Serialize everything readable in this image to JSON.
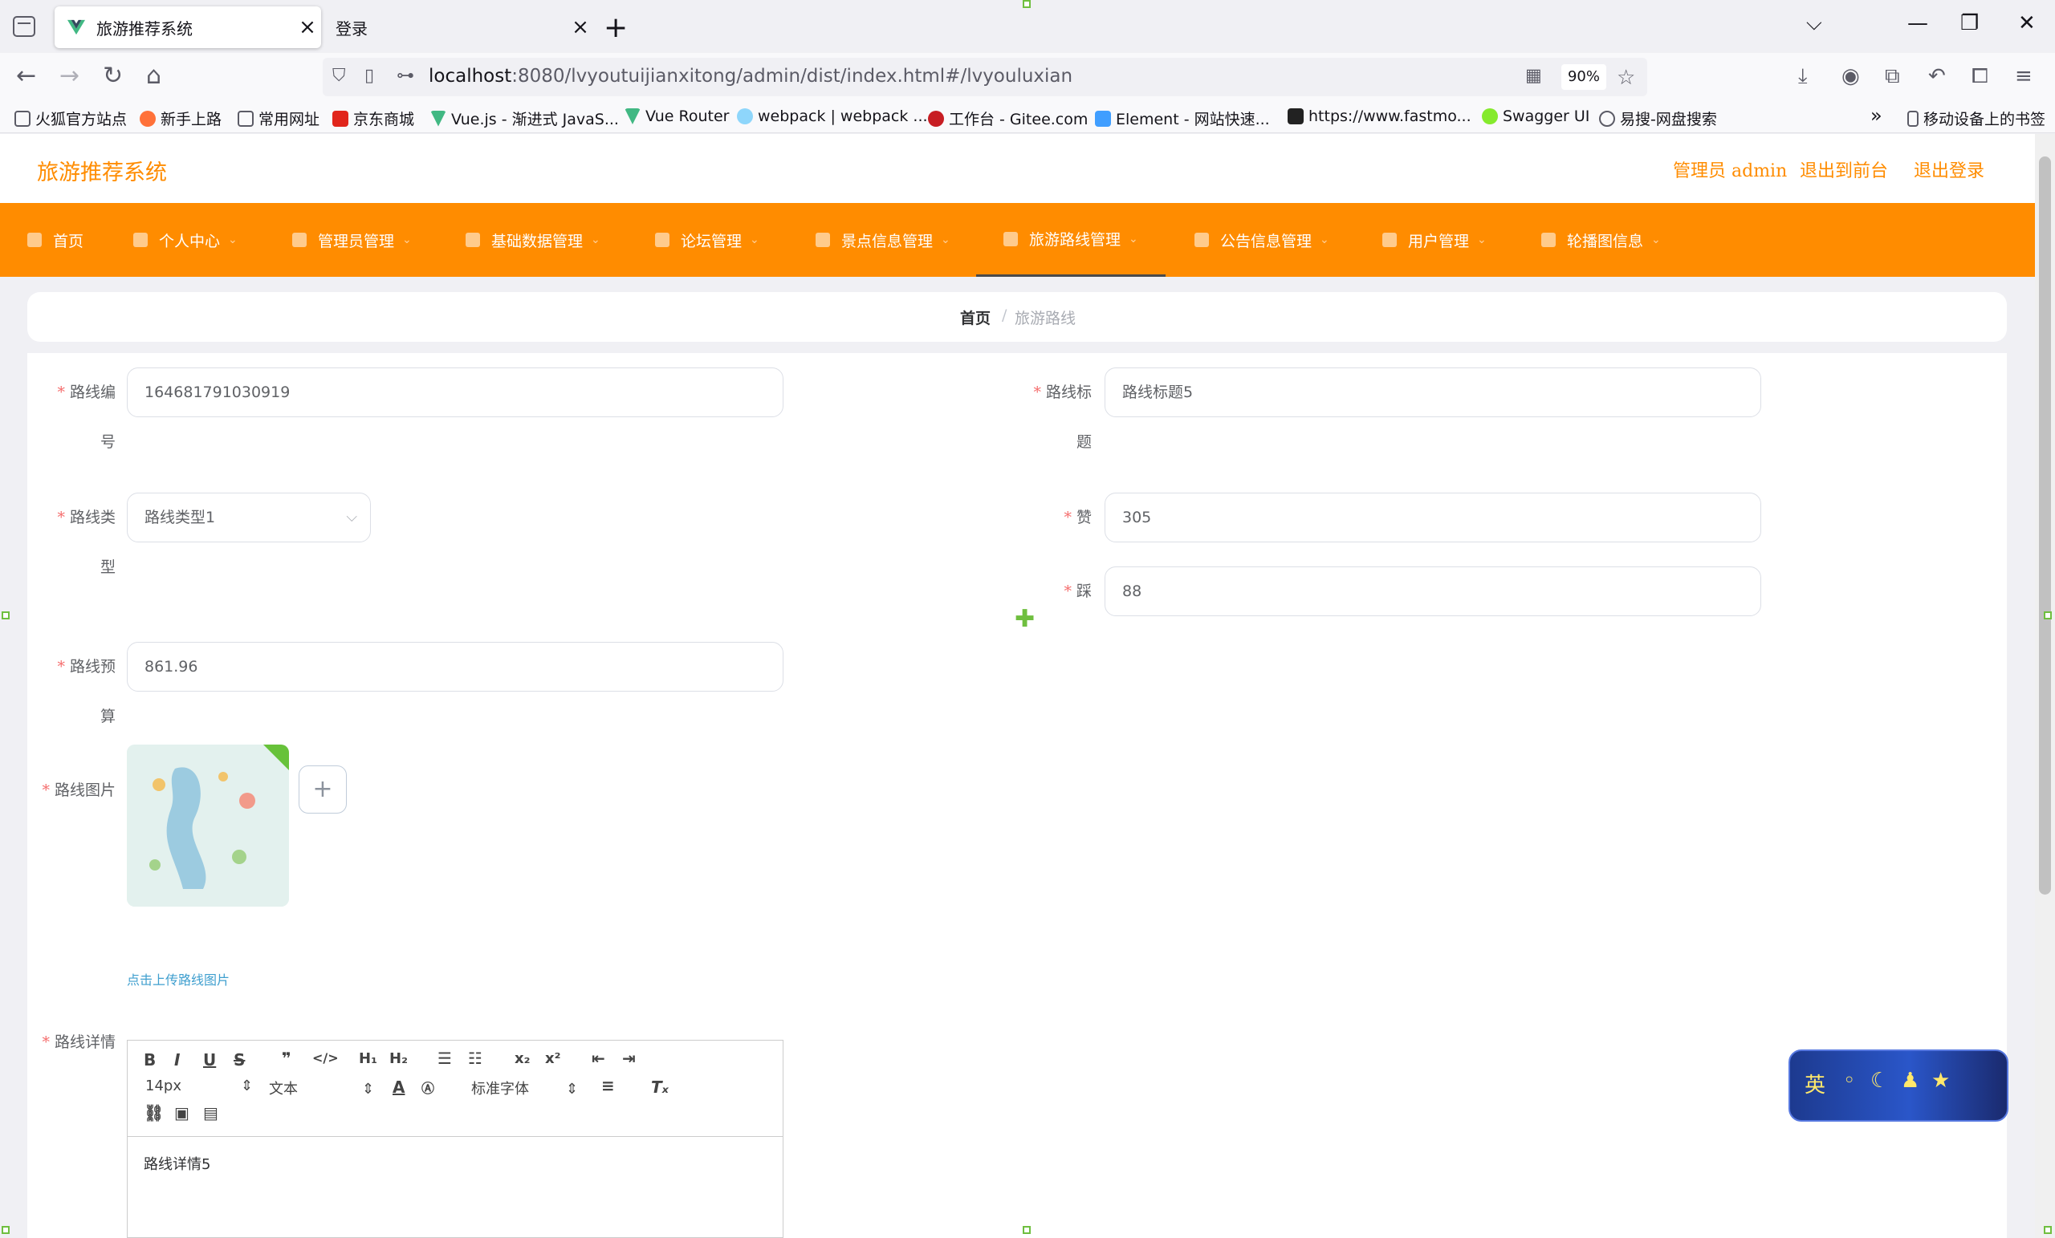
{
  "browser": {
    "tabs": [
      {
        "label": "旅游推荐系统",
        "active": true
      },
      {
        "label": "登录",
        "active": false
      }
    ],
    "url_host": "localhost",
    "url_rest": ":8080/lvyoutuijianxitong/admin/dist/index.html#/lvyouluxian",
    "zoom": "90%",
    "bookmarks": [
      "火狐官方站点",
      "新手上路",
      "常用网址",
      "京东商城",
      "Vue.js - 渐进式 JavaS...",
      "Vue Router",
      "webpack | webpack ...",
      "工作台 - Gitee.com",
      "Element - 网站快速...",
      "https://www.fastmo...",
      "Swagger UI",
      "易搜-网盘搜索"
    ],
    "mobile_bookmarks": "移动设备上的书签"
  },
  "header": {
    "title": "旅游推荐系统",
    "admin_label": "管理员 admin",
    "front_label": "退出到前台",
    "logout_label": "退出登录"
  },
  "menu": [
    {
      "label": "首页"
    },
    {
      "label": "个人中心"
    },
    {
      "label": "管理员管理"
    },
    {
      "label": "基础数据管理"
    },
    {
      "label": "论坛管理"
    },
    {
      "label": "景点信息管理"
    },
    {
      "label": "旅游路线管理"
    },
    {
      "label": "公告信息管理"
    },
    {
      "label": "用户管理"
    },
    {
      "label": "轮播图信息"
    }
  ],
  "breadcrumb": {
    "home": "首页",
    "sep": "/",
    "current": "旅游路线"
  },
  "form": {
    "route_no": {
      "label1": "路线编",
      "label2": "号",
      "value": "164681791030919"
    },
    "route_title": {
      "label1": "路线标",
      "label2": "题",
      "value": "路线标题5"
    },
    "route_type": {
      "label1": "路线类",
      "label2": "型",
      "value": "路线类型1"
    },
    "likes": {
      "label": "赞",
      "value": "305"
    },
    "dislikes": {
      "label": "踩",
      "value": "88"
    },
    "budget": {
      "label1": "路线预",
      "label2": "算",
      "value": "861.96"
    },
    "image": {
      "label": "路线图片",
      "tip": "点击上传路线图片",
      "add": "+"
    },
    "detail": {
      "label": "路线详情",
      "font_size": "14px",
      "block": "文本",
      "font_family": "标准字体",
      "content": "路线详情5"
    }
  },
  "ime": {
    "text": "英"
  }
}
